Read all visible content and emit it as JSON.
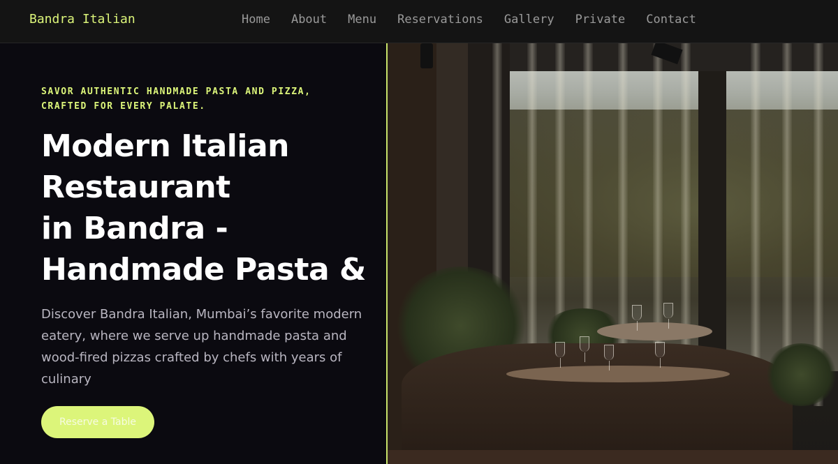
{
  "header": {
    "brand": "Bandra Italian",
    "nav": [
      "Home",
      "About",
      "Menu",
      "Reservations",
      "Gallery",
      "Private",
      "Contact"
    ]
  },
  "hero": {
    "tagline": "Savor authentic handmade pasta and pizza, crafted for every palate.",
    "headline_lines": [
      "Modern Italian",
      "Restaurant",
      "in Bandra -",
      "Handmade Pasta &"
    ],
    "description": "Discover Bandra Italian, Mumbai’s favorite modern eatery, where we serve up handmade pasta and wood-fired pizzas crafted by chefs with years of culinary",
    "cta_label": "Reserve a Table"
  },
  "colors": {
    "accent": "#dcf57a",
    "background": "#0b0a10",
    "header_bg": "#141414",
    "nav_text": "#9a9a9a",
    "body_text": "#b9b6c1"
  }
}
